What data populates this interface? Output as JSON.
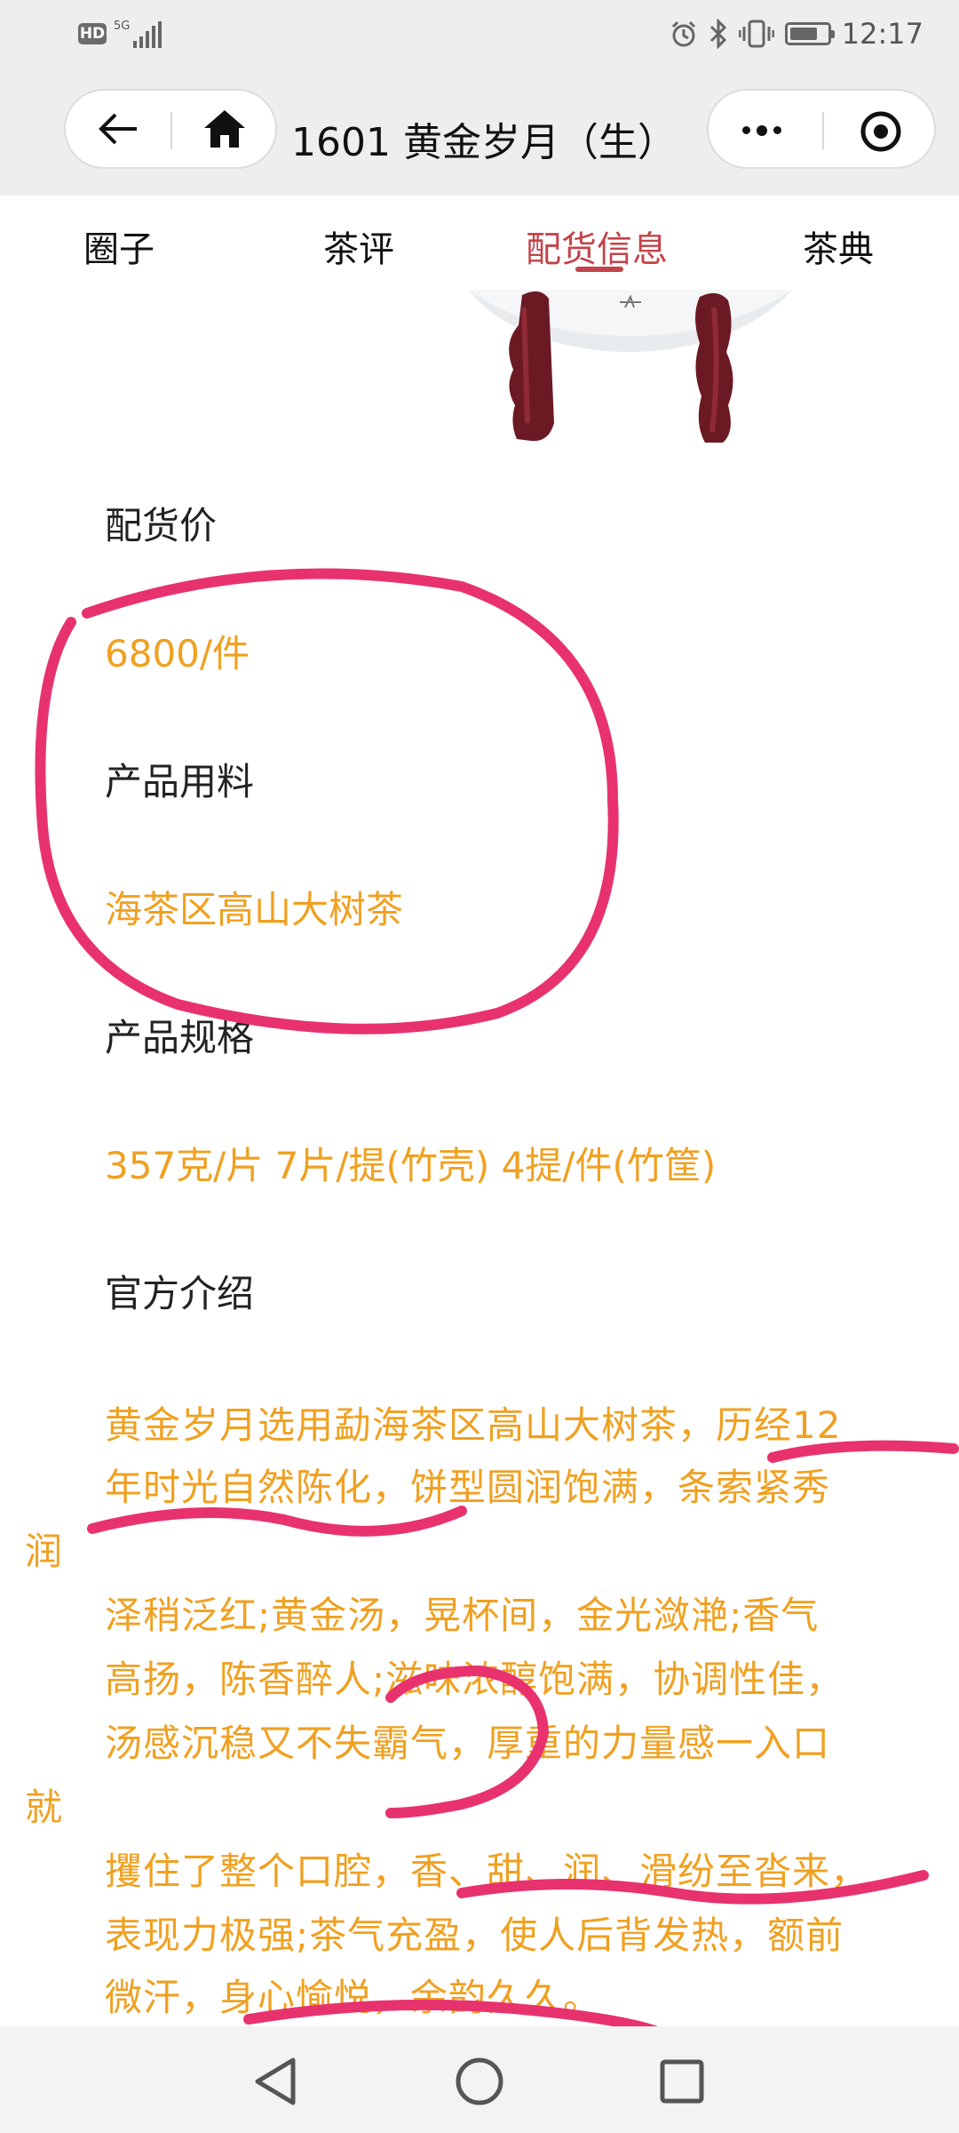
{
  "status_bar": {
    "hd_badge": "HD",
    "network": "5G",
    "time": "12:17",
    "battery_level": 0.75,
    "icons": [
      "alarm-icon",
      "bluetooth-icon",
      "vibrate-icon",
      "battery-icon",
      "signal-icon"
    ]
  },
  "nav": {
    "title": "1601 黄金岁月（生）",
    "icons": [
      "back-arrow-icon",
      "home-icon",
      "more-dots-icon",
      "record-target-icon"
    ]
  },
  "tabs": [
    {
      "label": "圈子",
      "active": false
    },
    {
      "label": "茶评",
      "active": false
    },
    {
      "label": "配货信息",
      "active": true
    },
    {
      "label": "茶典",
      "active": false
    }
  ],
  "sections": {
    "price": {
      "label": "配货价",
      "value": "6800/件"
    },
    "material": {
      "label": "产品用料",
      "value": "海茶区高山大树茶"
    },
    "spec": {
      "label": "产品规格",
      "value": "357克/片 7片/提(竹壳) 4提/件(竹筐)"
    },
    "intro": {
      "label": "官方介绍",
      "lines": [
        "黄金岁月选用勐海茶区高山大树茶，历经12",
        "年时光自然陈化，饼型圆润饱满，条索紧秀",
        "润",
        "泽稍泛红;黄金汤，晃杯间，金光潋滟;香气",
        "高扬，陈香醉人;滋味浓醇饱满，协调性佳，",
        "汤感沉稳又不失霸气，厚重的力量感一入口",
        "就",
        "攫住了整个口腔，香、甜、润、滑纷至沓来，",
        "表现力极强;茶气充盈，使人后背发热，额前",
        "微汗，身心愉悦，余韵久久。"
      ]
    }
  },
  "colors": {
    "accent_red": "#c4434a",
    "value_orange": "#f0a020",
    "annotation_pink": "#e8326e"
  },
  "system_nav": {
    "icons": [
      "back-triangle-icon",
      "home-circle-icon",
      "recents-square-icon"
    ]
  }
}
